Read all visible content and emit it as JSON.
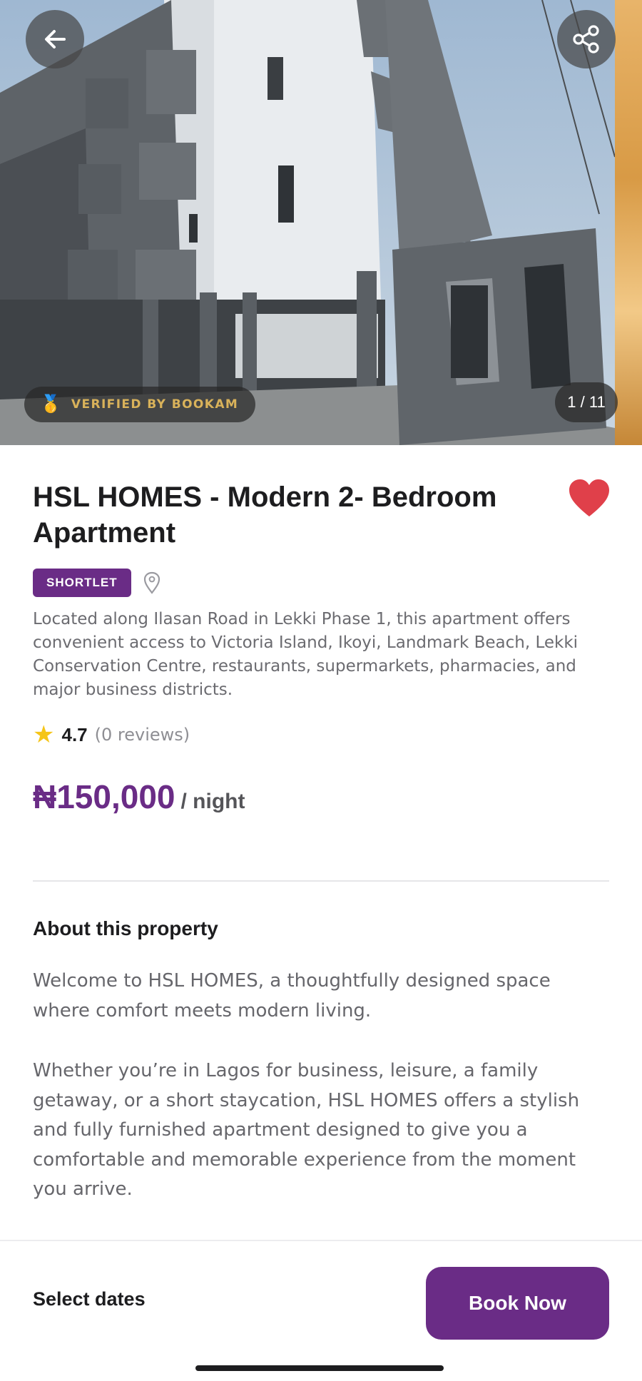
{
  "gallery": {
    "counter": "1 / 11",
    "verified_label": "VERIFIED BY BOOKAM",
    "back_icon": "arrow-left-icon",
    "share_icon": "share-icon"
  },
  "listing": {
    "title": "HSL HOMES - Modern 2- Bedroom Apartment",
    "category": "SHORTLET",
    "favorited": true,
    "description": "Located along Ilasan Road in Lekki Phase 1, this apartment offers convenient access to Victoria Island, Ikoyi, Landmark Beach, Lekki Conservation Centre, restaurants, supermarkets, pharmacies, and major business districts.",
    "rating": "4.7",
    "reviews": "(0 reviews)",
    "price": "₦150,000",
    "price_unit": "/ night"
  },
  "about": {
    "title": "About this property",
    "paragraph_1": "Welcome to HSL HOMES, a thoughtfully designed space where comfort meets modern living.",
    "paragraph_2": "Whether you’re in Lagos for business, leisure, a family getaway, or a short staycation, HSL HOMES offers a stylish and fully furnished apartment designed to give you a comfortable and memorable experience from the moment you arrive."
  },
  "footer": {
    "select_dates": "Select dates",
    "book_now": "Book Now"
  },
  "colors": {
    "brand": "#6a2c86",
    "favorite": "#e0404a",
    "star": "#f5c518",
    "verified_text": "#d9b25a"
  }
}
